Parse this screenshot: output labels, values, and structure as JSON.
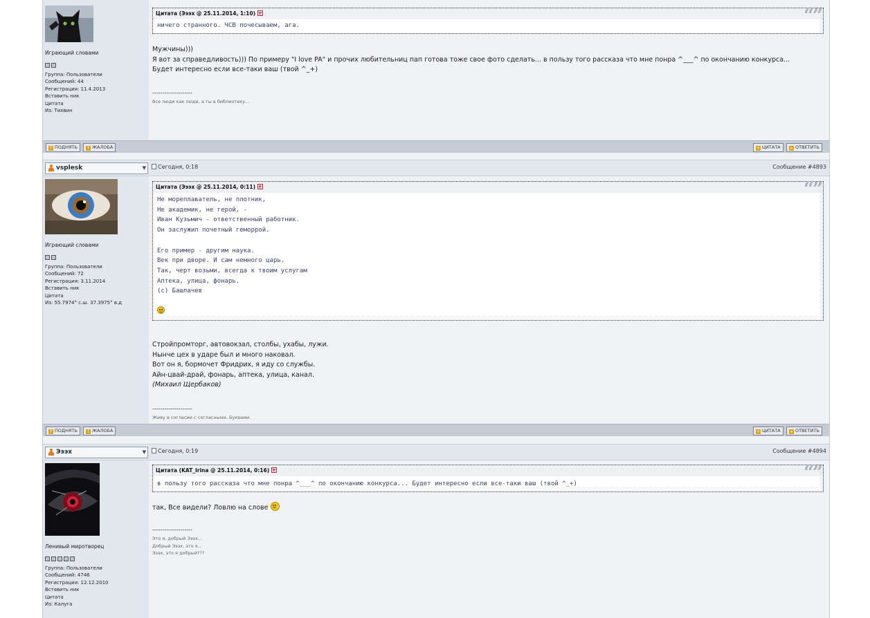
{
  "posts": [
    {
      "id": "p1",
      "user": {
        "title": "Играющий словами",
        "pips": 2,
        "info": [
          "Группа: Пользователи",
          "Сообщений: 44",
          "Регистрация: 11.4.2013",
          "Вставить ник",
          "Цитата",
          "Из: Тихвин"
        ]
      },
      "quote": {
        "header": "Цитата (Эээх @ 25.11.2014, 1:10)",
        "lines": [
          "ничего странного. ЧСВ почесываем, ага."
        ]
      },
      "text": [
        "Мужчины)))",
        "Я вот за справедливость))) По примеру \"I love PA\" и прочих любительниц пап готова тоже свое фото сделать... в пользу того рассказа что мне понра ^___^ по окончанию конкурса...",
        "Будет интересно если все-таки ваш (твой ^_+)"
      ],
      "signature": [
        "Все люди как люди, а ты в библиотеку..."
      ]
    },
    {
      "id": "p2",
      "user": {
        "name": "vsplesk",
        "title": "Играющий словами",
        "pips": 2,
        "info": [
          "Группа: Пользователи",
          "Сообщений: 72",
          "Регистрация: 3.11.2014",
          "Вставить ник",
          "Цитата",
          "Из: 55.7974° с.ш. 37.3975° в.д"
        ]
      },
      "date": "Сегодня, 0:18",
      "number": "Сообщение #4893",
      "quote": {
        "header": "Цитата (Эээх @ 25.11.2014, 0:11)",
        "lines": [
          "Не мореплаватель, не плотник,",
          "Не академик, не герой, -",
          "Иван Кузьмич - ответственный работник.",
          "Он заслужил почетный геморрой.",
          "",
          "Его пример - другим наука.",
          "Век при дворе. И сам немного царь.",
          "Так, черт возьми, всегда к твоим услугам",
          "Аптека, улица, фонарь.",
          "(c) Башлачев"
        ]
      },
      "text": [
        "Стройпромторг, автовокзал, столбы, ухабы, лужи.",
        "Нынче цех в ударе был и много наковал.",
        "Вот он я, бормочет Фридрих, я иду со службы.",
        "Айн-цвай-драй, фонарь, аптека, улица, канал.",
        "(Михаил Щербаков)"
      ],
      "signature": [
        "Живу в согласии с согласными. Буквами."
      ]
    },
    {
      "id": "p3",
      "user": {
        "name": "Эээх",
        "title": "Ленивый миротворец",
        "pips": 5,
        "info": [
          "Группа: Пользователи",
          "Сообщений: 4746",
          "Регистрация: 12.12.2010",
          "Вставить ник",
          "Цитата",
          "Из: Калуга"
        ]
      },
      "date": "Сегодня, 0:19",
      "number": "Сообщение #4894",
      "quote": {
        "header": "Цитата (KAT_Irina @ 25.11.2014, 0:16)",
        "lines": [
          "в пользу того рассказа что мне понра ^___^ по окончанию конкурса... Будет интересно если все-таки ваш (твой ^_+)"
        ]
      },
      "text": [
        "так, Все видели? Ловлю на слове"
      ],
      "signature": [
        "Это я, добрый Эээх...",
        "Добрый Эээх, это я...",
        "Эээх, это я добрый???"
      ]
    }
  ],
  "buttons": {
    "up": "ПОДНЯТЬ",
    "complain": "ЖАЛОБА",
    "quote": "ЦИТАТА",
    "reply": "ОТВЕТИТЬ"
  },
  "signature_divider": "--------------------",
  "icons": [
    "cat-avatar",
    "eye-avatar",
    "red-eye-avatar",
    "quote-marks-icon",
    "expand-icon",
    "smiley-icon",
    "document-icon",
    "user-icon"
  ]
}
